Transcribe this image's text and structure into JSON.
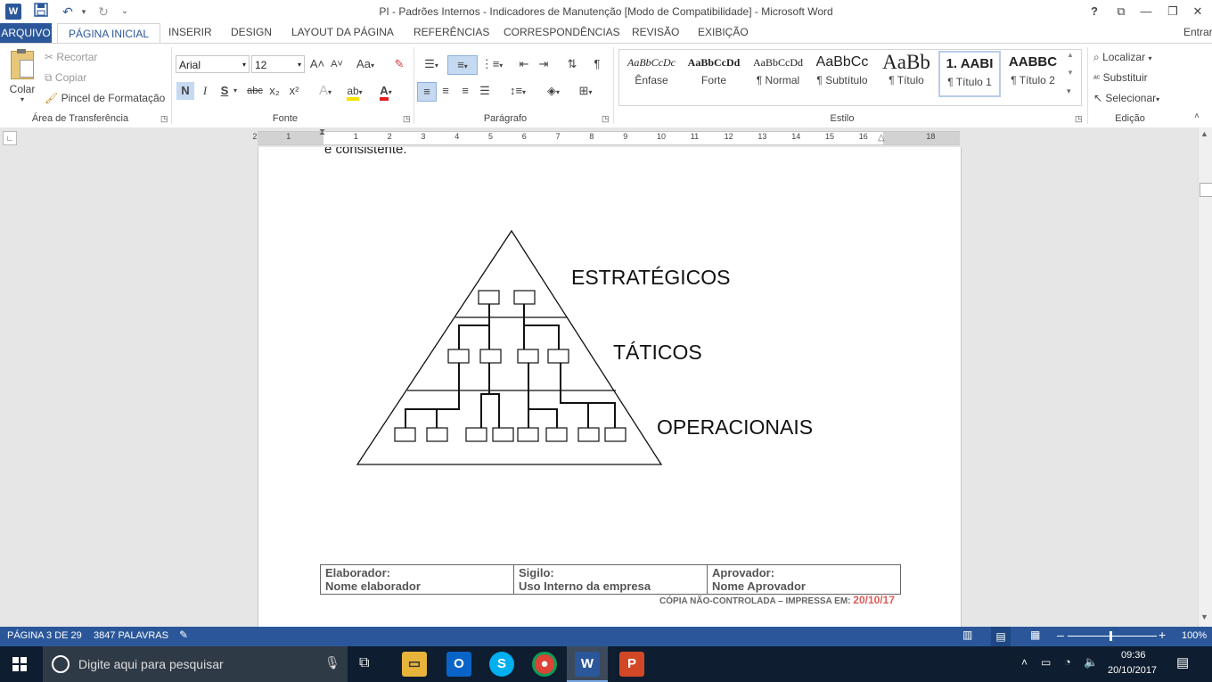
{
  "titlebar": {
    "title": "PI - Padrões Internos - Indicadores de Manutenção [Modo de Compatibilidade] - Microsoft Word",
    "help": "?",
    "ribbon_display": "⧉",
    "minimize": "—",
    "restore": "❐",
    "close": "✕",
    "qa_undo": "↶",
    "qa_redo": "↻",
    "qa_more": "⌄"
  },
  "tabs": {
    "file": "ARQUIVO",
    "home": "PÁGINA INICIAL",
    "insert": "INSERIR",
    "design": "DESIGN",
    "layout": "LAYOUT DA PÁGINA",
    "references": "REFERÊNCIAS",
    "mailings": "CORRESPONDÊNCIAS",
    "review": "REVISÃO",
    "view": "EXIBIÇÃO",
    "signin": "Entrar"
  },
  "clipboard": {
    "paste": "Colar",
    "cut": "Recortar",
    "copy": "Copiar",
    "format_painter": "Pincel de Formatação",
    "label": "Área de Transferência"
  },
  "font": {
    "name": "Arial",
    "size": "12",
    "grow": "A˄",
    "shrink": "A˅",
    "case": "Aa",
    "bold": "N",
    "italic": "I",
    "underline": "S",
    "strike": "abc",
    "sub": "x₂",
    "sup": "x²",
    "effects": "A",
    "highlight": "ab",
    "color": "A",
    "label": "Fonte"
  },
  "paragraph": {
    "label": "Parágrafo",
    "show_marks": "¶"
  },
  "styles": {
    "label": "Estilo",
    "items": [
      {
        "preview": "AaBbCcDc",
        "name": "Ênfase"
      },
      {
        "preview": "AaBbCcDd",
        "name": "Forte"
      },
      {
        "preview": "AaBbCcDd",
        "name": "¶ Normal"
      },
      {
        "preview": "AaBbCc",
        "name": "¶ Subtítulo"
      },
      {
        "preview": "AaBb",
        "name": "¶ Título"
      },
      {
        "preview": "1. AABI",
        "name": "¶ Título 1"
      },
      {
        "preview": "AABBC",
        "name": "¶ Título 2"
      }
    ]
  },
  "editing": {
    "find": "Localizar",
    "replace": "Substituir",
    "select": "Selecionar",
    "label": "Edição"
  },
  "ruler": {
    "ticks": [
      "2",
      "1",
      "1",
      "2",
      "3",
      "4",
      "5",
      "6",
      "7",
      "8",
      "9",
      "10",
      "11",
      "12",
      "13",
      "14",
      "15",
      "16",
      "18"
    ]
  },
  "document": {
    "partial_text": "e consistente.",
    "levels": {
      "strategic": "ESTRATÉGICOS",
      "tactical": "TÁTICOS",
      "operational": "OPERACIONAIS"
    },
    "footer": {
      "author_label": "Elaborador:",
      "author_value": "Nome elaborador",
      "secrecy_label": "Sigilo:",
      "secrecy_value": "Uso Interno da empresa",
      "approver_label": "Aprovador:",
      "approver_value": "Nome Aprovador",
      "copy_note": "CÓPIA NÃO-CONTROLADA – IMPRESSA EM:",
      "print_date": "20/10/17"
    }
  },
  "status": {
    "page": "PÁGINA 3 DE 29",
    "words": "3847 PALAVRAS",
    "zoom": "100%"
  },
  "taskbar": {
    "search_placeholder": "Digite aqui para pesquisar",
    "time": "09:36",
    "date": "20/10/2017"
  }
}
